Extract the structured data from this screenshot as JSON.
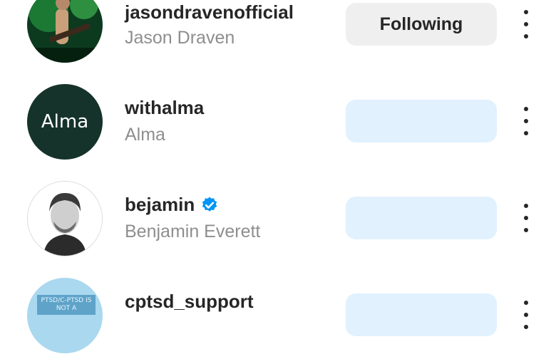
{
  "rows": [
    {
      "username": "jasondravenofficial",
      "full_name": "Jason Draven",
      "button_label": "Following",
      "button_state": "following",
      "avatar": "concert-photo-avatar"
    },
    {
      "username": "withalma",
      "full_name": "Alma",
      "button_label": "",
      "button_state": "loading",
      "avatar_text": "Alma"
    },
    {
      "username": "bejamin",
      "full_name": "Benjamin Everett",
      "verified": true,
      "button_label": "",
      "button_state": "loading",
      "avatar": "portrait-avatar"
    },
    {
      "username": "cptsd_support",
      "full_name": "",
      "button_label": "",
      "button_state": "loading",
      "avatar_text": "PTSD/C-PTSD IS NOT A"
    }
  ],
  "colors": {
    "following_bg": "#efefef",
    "loading_bg": "#e1f1fe",
    "verified_blue": "#0095f6",
    "alma_bg": "#15332a"
  }
}
